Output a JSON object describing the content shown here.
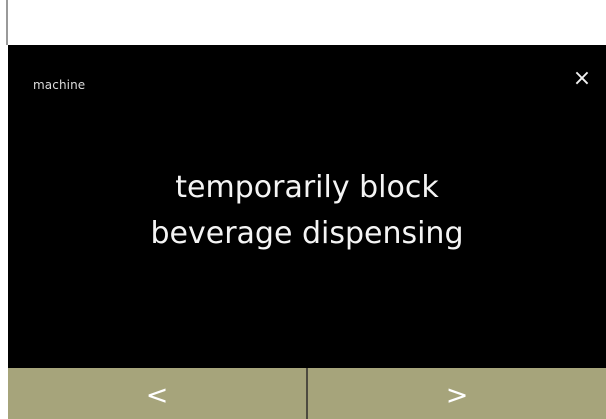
{
  "screen": {
    "title": "machine",
    "close_icon": "close-icon",
    "message_line1": "temporarily block",
    "message_line2": "beverage dispensing"
  },
  "footer": {
    "prev_icon": "chevron-left-icon",
    "next_icon": "chevron-right-icon",
    "prev_glyph": "<",
    "next_glyph": ">"
  },
  "colors": {
    "background": "#000000",
    "footer_button": "#a6a47b",
    "text": "#f4f4f4"
  }
}
